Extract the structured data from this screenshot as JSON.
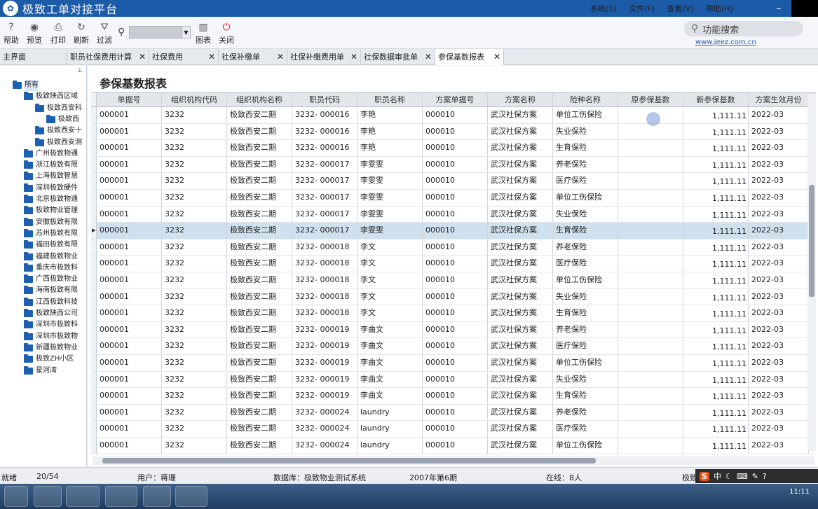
{
  "window": {
    "title": "极致工单对接平台",
    "logo_glyph": "✿",
    "menu": [
      "系统(S)·",
      "文件(F)·",
      "查看(V)·",
      "帮助(H)·"
    ],
    "minimize_glyph": "–",
    "close_glyph": "✕"
  },
  "toolbar": {
    "buttons": [
      {
        "label": "帮助",
        "icon": "help-icon",
        "glyph": "?"
      },
      {
        "label": "预览",
        "icon": "eye-icon",
        "glyph": "◉"
      },
      {
        "label": "打印",
        "icon": "printer-icon",
        "glyph": "⎙"
      },
      {
        "label": "刷新",
        "icon": "refresh-icon",
        "glyph": "↻"
      },
      {
        "label": "过滤",
        "icon": "filter-icon",
        "glyph": "⛛"
      },
      {
        "label": "图表",
        "icon": "chart-icon",
        "glyph": "▥"
      },
      {
        "label": "关闭",
        "icon": "power-icon",
        "glyph": "⏻"
      }
    ],
    "search_value": "",
    "func_search_placeholder": "功能搜索",
    "website": "www.jeez.com.cn"
  },
  "tabs": [
    {
      "label": "主界面",
      "active": false
    },
    {
      "label": "职员社保费用计算",
      "active": false
    },
    {
      "label": "社保费用",
      "active": false
    },
    {
      "label": "社保补缴单",
      "active": false
    },
    {
      "label": "社保补缴费用单",
      "active": false
    },
    {
      "label": "社保数据审批单",
      "active": false
    },
    {
      "label": "参保基数报表",
      "active": true
    }
  ],
  "tab_close_glyph": "✕",
  "tree": {
    "pin_glyph": "⊥",
    "nodes": [
      {
        "label": "所有",
        "level": 0,
        "selected": true
      },
      {
        "label": "极致陕西区域",
        "level": 1
      },
      {
        "label": "极致西安科",
        "level": 2
      },
      {
        "label": "极致西",
        "level": 3
      },
      {
        "label": "极致西安十",
        "level": 2
      },
      {
        "label": "极致西安测",
        "level": 2
      },
      {
        "label": "广州极致物通",
        "level": 1
      },
      {
        "label": "浙江极致有限",
        "level": 1
      },
      {
        "label": "上海极致智慧",
        "level": 1
      },
      {
        "label": "深圳极致硬件",
        "level": 1
      },
      {
        "label": "北京极致物通",
        "level": 1
      },
      {
        "label": "极致物业管理",
        "level": 1
      },
      {
        "label": "安徽极致有限",
        "level": 1
      },
      {
        "label": "苏州极致有限",
        "level": 1
      },
      {
        "label": "福田极致有限",
        "level": 1
      },
      {
        "label": "福建极致物业",
        "level": 1
      },
      {
        "label": "重庆市极致科",
        "level": 1
      },
      {
        "label": "广西极致物业",
        "level": 1
      },
      {
        "label": "海南极致有限",
        "level": 1
      },
      {
        "label": "江西极致科技",
        "level": 1
      },
      {
        "label": "极致陕西公司",
        "level": 1
      },
      {
        "label": "深圳市极致科",
        "level": 1
      },
      {
        "label": "深圳市极致物",
        "level": 1
      },
      {
        "label": "新疆极致物业",
        "level": 1
      },
      {
        "label": "极致ZH小区",
        "level": 1
      },
      {
        "label": "星河湾",
        "level": 1
      }
    ]
  },
  "report": {
    "title": "参保基数报表",
    "columns": [
      "单据号",
      "组织机构代码",
      "组织机构名称",
      "职员代码",
      "职员名称",
      "方案单据号",
      "方案名称",
      "险种名称",
      "原参保基数",
      "新参保基数",
      "方案生效月份"
    ],
    "rows": [
      [
        "000001",
        "3232",
        "极致西安二期",
        "3232- 000016",
        "李艳",
        "000010",
        "武汉社保方案",
        "单位工伤保险",
        "",
        "1,111.11",
        "2022-03"
      ],
      [
        "000001",
        "3232",
        "极致西安二期",
        "3232- 000016",
        "李艳",
        "000010",
        "武汉社保方案",
        "失业保险",
        "",
        "1,111.11",
        "2022-03"
      ],
      [
        "000001",
        "3232",
        "极致西安二期",
        "3232- 000016",
        "李艳",
        "000010",
        "武汉社保方案",
        "生育保险",
        "",
        "1,111.11",
        "2022-03"
      ],
      [
        "000001",
        "3232",
        "极致西安二期",
        "3232- 000017",
        "李雯雯",
        "000010",
        "武汉社保方案",
        "养老保险",
        "",
        "1,111.11",
        "2022-03"
      ],
      [
        "000001",
        "3232",
        "极致西安二期",
        "3232- 000017",
        "李雯雯",
        "000010",
        "武汉社保方案",
        "医疗保险",
        "",
        "1,111.11",
        "2022-03"
      ],
      [
        "000001",
        "3232",
        "极致西安二期",
        "3232- 000017",
        "李雯雯",
        "000010",
        "武汉社保方案",
        "单位工伤保险",
        "",
        "1,111.11",
        "2022-03"
      ],
      [
        "000001",
        "3232",
        "极致西安二期",
        "3232- 000017",
        "李雯雯",
        "000010",
        "武汉社保方案",
        "失业保险",
        "",
        "1,111.11",
        "2022-03"
      ],
      [
        "000001",
        "3232",
        "极致西安二期",
        "3232- 000017",
        "李雯雯",
        "000010",
        "武汉社保方案",
        "生育保险",
        "",
        "1,111.11",
        "2022-03"
      ],
      [
        "000001",
        "3232",
        "极致西安二期",
        "3232- 000018",
        "李文",
        "000010",
        "武汉社保方案",
        "养老保险",
        "",
        "1,111.11",
        "2022-03"
      ],
      [
        "000001",
        "3232",
        "极致西安二期",
        "3232- 000018",
        "李文",
        "000010",
        "武汉社保方案",
        "医疗保险",
        "",
        "1,111.11",
        "2022-03"
      ],
      [
        "000001",
        "3232",
        "极致西安二期",
        "3232- 000018",
        "李文",
        "000010",
        "武汉社保方案",
        "单位工伤保险",
        "",
        "1,111.11",
        "2022-03"
      ],
      [
        "000001",
        "3232",
        "极致西安二期",
        "3232- 000018",
        "李文",
        "000010",
        "武汉社保方案",
        "失业保险",
        "",
        "1,111.11",
        "2022-03"
      ],
      [
        "000001",
        "3232",
        "极致西安二期",
        "3232- 000018",
        "李文",
        "000010",
        "武汉社保方案",
        "生育保险",
        "",
        "1,111.11",
        "2022-03"
      ],
      [
        "000001",
        "3232",
        "极致西安二期",
        "3232- 000019",
        "李曲文",
        "000010",
        "武汉社保方案",
        "养老保险",
        "",
        "1,111.11",
        "2022-03"
      ],
      [
        "000001",
        "3232",
        "极致西安二期",
        "3232- 000019",
        "李曲文",
        "000010",
        "武汉社保方案",
        "医疗保险",
        "",
        "1,111.11",
        "2022-03"
      ],
      [
        "000001",
        "3232",
        "极致西安二期",
        "3232- 000019",
        "李曲文",
        "000010",
        "武汉社保方案",
        "单位工伤保险",
        "",
        "1,111.11",
        "2022-03"
      ],
      [
        "000001",
        "3232",
        "极致西安二期",
        "3232- 000019",
        "李曲文",
        "000010",
        "武汉社保方案",
        "失业保险",
        "",
        "1,111.11",
        "2022-03"
      ],
      [
        "000001",
        "3232",
        "极致西安二期",
        "3232- 000019",
        "李曲文",
        "000010",
        "武汉社保方案",
        "生育保险",
        "",
        "1,111.11",
        "2022-03"
      ],
      [
        "000001",
        "3232",
        "极致西安二期",
        "3232- 000024",
        "laundry",
        "000010",
        "武汉社保方案",
        "养老保险",
        "",
        "1,111.11",
        "2022-03"
      ],
      [
        "000001",
        "3232",
        "极致西安二期",
        "3232- 000024",
        "laundry",
        "000010",
        "武汉社保方案",
        "医疗保险",
        "",
        "1,111.11",
        "2022-03"
      ],
      [
        "000001",
        "3232",
        "极致西安二期",
        "3232- 000024",
        "laundry",
        "000010",
        "武汉社保方案",
        "单位工伤保险",
        "",
        "1,111.11",
        "2022-03"
      ]
    ],
    "selected_row": 7,
    "row_marker_glyph": "▶"
  },
  "status": {
    "state": "就绪",
    "record_count": "20/54",
    "user": "用户：蒋珊",
    "database": "数据库：极致物业测试系统",
    "period": "2007年第6期",
    "online": "在线：8人",
    "extra": "极致"
  },
  "tray": {
    "ime_logo": "S",
    "ime_mode": "中",
    "clock": "11:11"
  },
  "colors": {
    "title_bar": "#1c5ba8",
    "folder": "#1d5fb0",
    "selected_row": "#cfe0ee"
  }
}
